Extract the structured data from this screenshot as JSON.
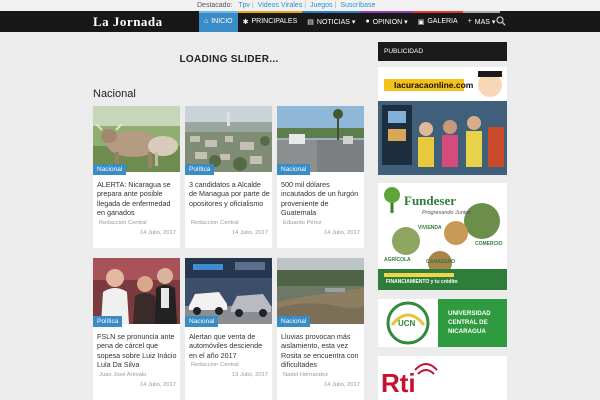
{
  "topbar": {
    "label": "Destacado:",
    "links": [
      "Tpv",
      "Videos Virales",
      "Juegos",
      "Suscríbase"
    ]
  },
  "nav": {
    "logo": "La Jornada",
    "items": [
      {
        "icon": "home-icon",
        "glyph": "⌂",
        "label": "INICIO"
      },
      {
        "icon": "star-icon",
        "glyph": "✱",
        "label": "PRINCIPALES"
      },
      {
        "icon": "newspaper-icon",
        "glyph": "▤",
        "label": "NOTICIAS ▾"
      },
      {
        "icon": "speech-bubble-icon",
        "glyph": "●",
        "label": "OPINION ▾"
      },
      {
        "icon": "image-icon",
        "glyph": "▣",
        "label": "GALERIA"
      },
      {
        "icon": "plus-icon",
        "glyph": "+",
        "label": "MAS ▾"
      }
    ]
  },
  "slider": {
    "text": "LOADING SLIDER..."
  },
  "section": {
    "title": "Nacional"
  },
  "cards": [
    {
      "category": "Nacional",
      "title": "ALERTA: Nicaragua se prepara ante posible llegada de enfermedad en ganados",
      "author": "Redaccion Central",
      "date": "14 Julio, 2017"
    },
    {
      "category": "Política",
      "title": "3 candidatos a Alcalde de Managua por parte de opositores y oficialismo",
      "author": "Redaccion Central",
      "date": "14 Julio, 2017"
    },
    {
      "category": "Nacional",
      "title": "500 mil dólares incautados de un furgón proveniente de Guatemala",
      "author": "Eduardo Pérez",
      "date": "14 Julio, 2017"
    },
    {
      "category": "Política",
      "title": "FSLN se pronuncia ante pena de cárcel que sopesa sobre Luiz Inácio Lula Da Silva",
      "author": "Juan José Arévalo",
      "date": "14 Julio, 2017"
    },
    {
      "category": "Nacional",
      "title": "Alertan que venta de automóviles desciende en el año 2017",
      "author": "Redaccion Central",
      "date": "13 Julio, 2017"
    },
    {
      "category": "Nacional",
      "title": "Lluvias provocan más aislamiento, esta vez Rosita se encuentra con dificultades",
      "author": "Nadel Hernandez",
      "date": "14 Julio, 2017"
    }
  ],
  "sidebar": {
    "header": "PUBLICIDAD",
    "ads": {
      "lacuracao": {
        "text": "lacuracaonline.com"
      },
      "fundeser": {
        "brand": "Fundeser",
        "tagline": "Progresando Juntos",
        "labels": [
          "VIVIENDA",
          "COMERCIO",
          "AGRÍCOLA",
          "GANADERO"
        ],
        "footer": "FINANCIAMIENTO y tu crédito"
      },
      "ucn": {
        "logo": "UCN",
        "line1": "UNIVERSIDAD",
        "line2": "CENTRAL DE",
        "line3": "NICARAGUA"
      },
      "rti": {
        "text": "Rti"
      }
    }
  }
}
